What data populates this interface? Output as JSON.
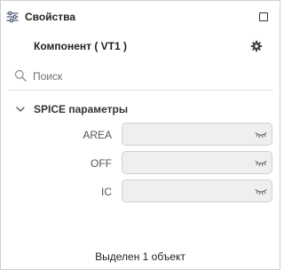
{
  "header": {
    "title": "Свойства",
    "icon": "sliders-icon"
  },
  "component": {
    "title": "Компонент ( VT1 )",
    "settings_icon": "gear-icon"
  },
  "search": {
    "placeholder": "Поиск",
    "value": "",
    "icon": "search-icon"
  },
  "section": {
    "title": "SPICE параметры",
    "expanded": true,
    "params": [
      {
        "label": "AREA",
        "value": ""
      },
      {
        "label": "OFF",
        "value": ""
      },
      {
        "label": "IC",
        "value": ""
      }
    ]
  },
  "status": {
    "text": "Выделен 1 объект"
  }
}
